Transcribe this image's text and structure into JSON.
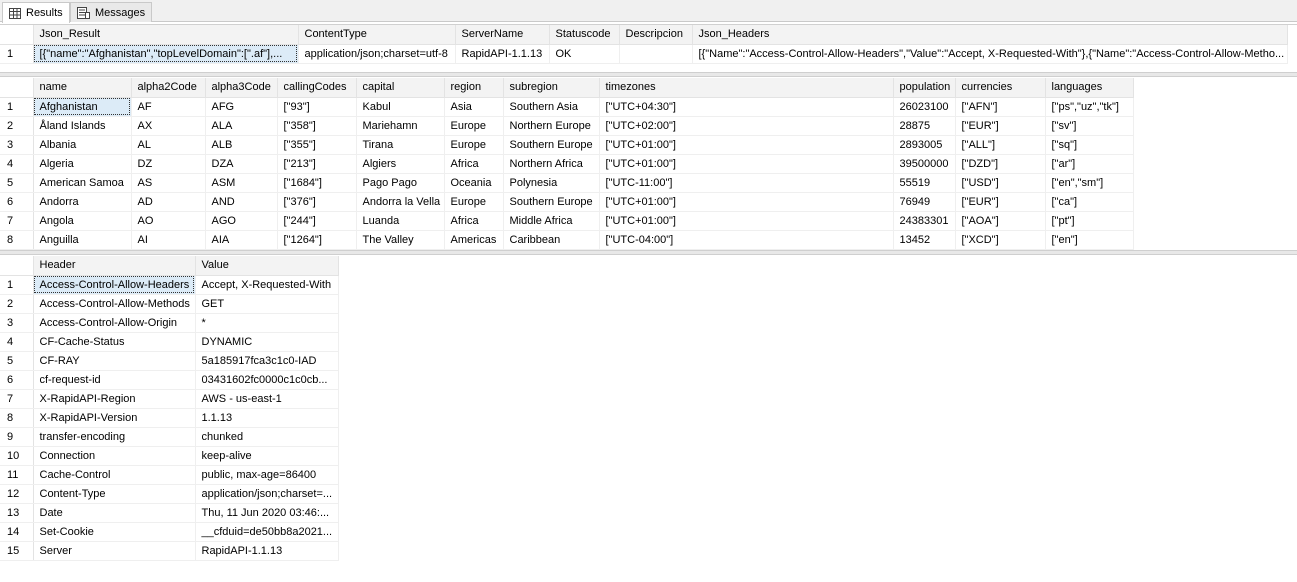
{
  "tabs": [
    {
      "label": "Results",
      "icon": "grid-icon",
      "active": true
    },
    {
      "label": "Messages",
      "icon": "messages-icon",
      "active": false
    }
  ],
  "grid1": {
    "columns": [
      "Json_Result",
      "ContentType",
      "ServerName",
      "Statuscode",
      "Descripcion",
      "Json_Headers"
    ],
    "rows": [
      {
        "rn": "1",
        "cells": [
          "[{\"name\":\"Afghanistan\",\"topLevelDomain\":[\".af\"],...",
          "application/json;charset=utf-8",
          "RapidAPI-1.1.13",
          "OK",
          "",
          "[{\"Name\":\"Access-Control-Allow-Headers\",\"Value\":\"Accept, X-Requested-With\"},{\"Name\":\"Access-Control-Allow-Metho..."
        ]
      }
    ]
  },
  "grid2": {
    "columns": [
      "name",
      "alpha2Code",
      "alpha3Code",
      "callingCodes",
      "capital",
      "region",
      "subregion",
      "timezones",
      "population",
      "currencies",
      "languages"
    ],
    "rows": [
      {
        "rn": "1",
        "cells": [
          "Afghanistan",
          "AF",
          "AFG",
          "[\"93\"]",
          "Kabul",
          "Asia",
          "Southern Asia",
          "[\"UTC+04:30\"]",
          "26023100",
          "[\"AFN\"]",
          "[\"ps\",\"uz\",\"tk\"]"
        ]
      },
      {
        "rn": "2",
        "cells": [
          "Åland Islands",
          "AX",
          "ALA",
          "[\"358\"]",
          "Mariehamn",
          "Europe",
          "Northern Europe",
          "[\"UTC+02:00\"]",
          "28875",
          "[\"EUR\"]",
          "[\"sv\"]"
        ]
      },
      {
        "rn": "3",
        "cells": [
          "Albania",
          "AL",
          "ALB",
          "[\"355\"]",
          "Tirana",
          "Europe",
          "Southern Europe",
          "[\"UTC+01:00\"]",
          "2893005",
          "[\"ALL\"]",
          "[\"sq\"]"
        ]
      },
      {
        "rn": "4",
        "cells": [
          "Algeria",
          "DZ",
          "DZA",
          "[\"213\"]",
          "Algiers",
          "Africa",
          "Northern Africa",
          "[\"UTC+01:00\"]",
          "39500000",
          "[\"DZD\"]",
          "[\"ar\"]"
        ]
      },
      {
        "rn": "5",
        "cells": [
          "American Samoa",
          "AS",
          "ASM",
          "[\"1684\"]",
          "Pago Pago",
          "Oceania",
          "Polynesia",
          "[\"UTC-11:00\"]",
          "55519",
          "[\"USD\"]",
          "[\"en\",\"sm\"]"
        ]
      },
      {
        "rn": "6",
        "cells": [
          "Andorra",
          "AD",
          "AND",
          "[\"376\"]",
          "Andorra la Vella",
          "Europe",
          "Southern Europe",
          "[\"UTC+01:00\"]",
          "76949",
          "[\"EUR\"]",
          "[\"ca\"]"
        ]
      },
      {
        "rn": "7",
        "cells": [
          "Angola",
          "AO",
          "AGO",
          "[\"244\"]",
          "Luanda",
          "Africa",
          "Middle Africa",
          "[\"UTC+01:00\"]",
          "24383301",
          "[\"AOA\"]",
          "[\"pt\"]"
        ]
      },
      {
        "rn": "8",
        "cells": [
          "Anguilla",
          "AI",
          "AIA",
          "[\"1264\"]",
          "The Valley",
          "Americas",
          "Caribbean",
          "[\"UTC-04:00\"]",
          "13452",
          "[\"XCD\"]",
          "[\"en\"]"
        ]
      }
    ]
  },
  "grid3": {
    "columns": [
      "Header",
      "Value"
    ],
    "rows": [
      {
        "rn": "1",
        "cells": [
          "Access-Control-Allow-Headers",
          "Accept, X-Requested-With"
        ]
      },
      {
        "rn": "2",
        "cells": [
          "Access-Control-Allow-Methods",
          "GET"
        ]
      },
      {
        "rn": "3",
        "cells": [
          "Access-Control-Allow-Origin",
          "*"
        ]
      },
      {
        "rn": "4",
        "cells": [
          "CF-Cache-Status",
          "DYNAMIC"
        ]
      },
      {
        "rn": "5",
        "cells": [
          "CF-RAY",
          "5a185917fca3c1c0-IAD"
        ]
      },
      {
        "rn": "6",
        "cells": [
          "cf-request-id",
          "03431602fc0000c1c0cb..."
        ]
      },
      {
        "rn": "7",
        "cells": [
          "X-RapidAPI-Region",
          "AWS - us-east-1"
        ]
      },
      {
        "rn": "8",
        "cells": [
          "X-RapidAPI-Version",
          "1.1.13"
        ]
      },
      {
        "rn": "9",
        "cells": [
          "transfer-encoding",
          "chunked"
        ]
      },
      {
        "rn": "10",
        "cells": [
          "Connection",
          "keep-alive"
        ]
      },
      {
        "rn": "11",
        "cells": [
          "Cache-Control",
          "public, max-age=86400"
        ]
      },
      {
        "rn": "12",
        "cells": [
          "Content-Type",
          "application/json;charset=..."
        ]
      },
      {
        "rn": "13",
        "cells": [
          "Date",
          "Thu, 11 Jun 2020 03:46:..."
        ]
      },
      {
        "rn": "14",
        "cells": [
          "Set-Cookie",
          "__cfduid=de50bb8a2021..."
        ]
      },
      {
        "rn": "15",
        "cells": [
          "Server",
          "RapidAPI-1.1.13"
        ]
      }
    ]
  },
  "colors": {
    "selection": "#dcebf7",
    "header_bg": "#f3f3f3"
  }
}
